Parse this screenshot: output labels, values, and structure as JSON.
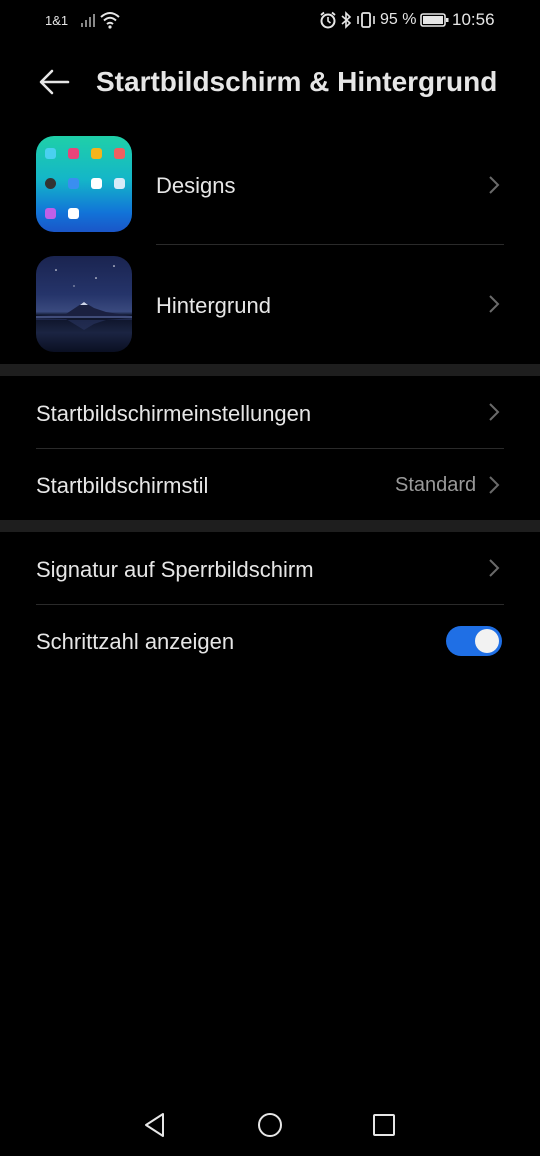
{
  "status_bar": {
    "carrier": "1&1",
    "battery_percent": "95 %",
    "time": "10:56",
    "icons": [
      "signal-icon",
      "wifi-icon",
      "alarm-icon",
      "bluetooth-icon",
      "vibrate-icon",
      "battery-icon"
    ]
  },
  "header": {
    "title": "Startbildschirm & Hintergrund",
    "back_icon": "arrow-left-icon"
  },
  "section1": {
    "items": [
      {
        "label": "Designs"
      },
      {
        "label": "Hintergrund"
      }
    ]
  },
  "section2": {
    "items": [
      {
        "label": "Startbildschirmeinstellungen"
      },
      {
        "label": "Startbildschirmstil",
        "value": "Standard"
      }
    ]
  },
  "section3": {
    "items": [
      {
        "label": "Signatur auf Sperrbildschirm"
      },
      {
        "label": "Schrittzahl anzeigen",
        "toggle_on": true
      }
    ]
  },
  "nav_bar": {
    "icons": [
      "back-triangle-icon",
      "home-circle-icon",
      "recents-square-icon"
    ]
  },
  "colors": {
    "background": "#000000",
    "text": "#e6e6e6",
    "secondary_text": "#9a9a9a",
    "accent": "#1f6fe5",
    "section_separator": "#1e1e1e"
  }
}
